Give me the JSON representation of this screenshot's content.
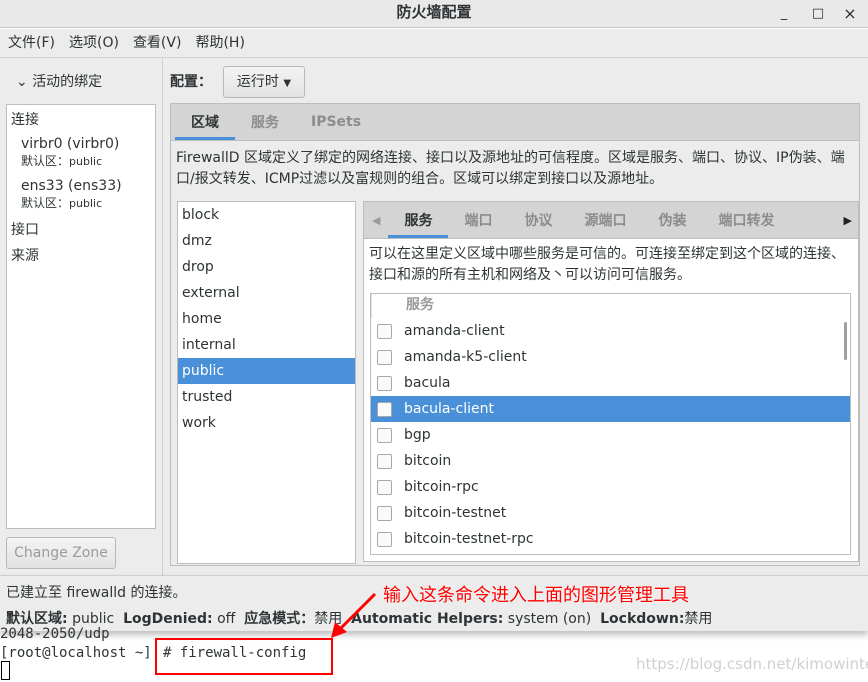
{
  "window": {
    "title": "防火墙配置",
    "minimize": "_",
    "maximize": "□",
    "close": "×"
  },
  "menu": [
    "文件(F)",
    "选项(O)",
    "查看(V)",
    "帮助(H)"
  ],
  "left": {
    "header": "活动的绑定",
    "connections_label": "连接",
    "connections": [
      {
        "name": "virbr0 (virbr0)",
        "zone_label": "默认区：",
        "zone": "public"
      },
      {
        "name": "ens33 (ens33)",
        "zone_label": "默认区：",
        "zone": "public"
      }
    ],
    "interfaces_label": "接口",
    "sources_label": "来源",
    "change_zone": "Change Zone"
  },
  "config": {
    "label": "配置：",
    "value": "运行时"
  },
  "main_tabs": [
    "区域",
    "服务",
    "IPSets"
  ],
  "zone_description": "FirewallD 区域定义了绑定的网络连接、接口以及源地址的可信程度。区域是服务、端口、协议、IP伪装、端口/报文转发、ICMP过滤以及富规则的组合。区域可以绑定到接口以及源地址。",
  "zones": [
    "block",
    "dmz",
    "drop",
    "external",
    "home",
    "internal",
    "public",
    "trusted",
    "work"
  ],
  "selected_zone": "public",
  "zone_tabs": [
    "服务",
    "端口",
    "协议",
    "源端口",
    "伪装",
    "端口转发"
  ],
  "services_description": "可以在这里定义区域中哪些服务是可信的。可连接至绑定到这个区域的连接、接口和源的所有主机和网络及丶可以访问可信服务。",
  "services_header": "服务",
  "services": [
    "amanda-client",
    "amanda-k5-client",
    "bacula",
    "bacula-client",
    "bgp",
    "bitcoin",
    "bitcoin-rpc",
    "bitcoin-testnet",
    "bitcoin-testnet-rpc"
  ],
  "selected_service": "bacula-client",
  "status": {
    "connection": "已建立至 firewalld 的连接。",
    "default_zone_label": "默认区域:",
    "default_zone": "public",
    "logdenied_label": "LogDenied:",
    "logdenied": "off",
    "panic_label": "应急模式：",
    "panic": "禁用",
    "helpers_label": "Automatic Helpers:",
    "helpers": "system (on)",
    "lockdown_label": "Lockdown:",
    "lockdown": "禁用"
  },
  "terminal": {
    "line1": "2048-2050/udp",
    "prompt": "[root@localhost ~]",
    "command": "# firewall-config"
  },
  "annotation": "输入这条命令进入上面的图形管理工具",
  "watermark": "https://blog.csdn.net/kimowinter",
  "colors": {
    "accent": "#4a90d9",
    "annotation": "#ff0000"
  }
}
